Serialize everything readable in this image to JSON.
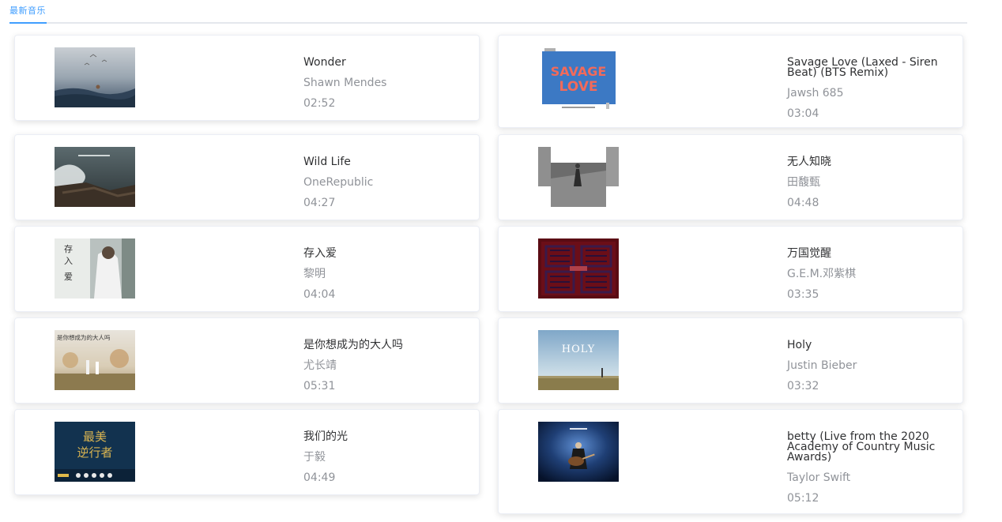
{
  "tabs": {
    "active_label": "最新音乐"
  },
  "songs": [
    {
      "title": "Wonder",
      "artist": "Shawn Mendes",
      "duration": "02:52"
    },
    {
      "title": "Savage Love (Laxed - Siren Beat) (BTS Remix)",
      "artist": "Jawsh 685",
      "duration": "03:04",
      "cover_text": "SAVAGE LOVE"
    },
    {
      "title": "Wild Life",
      "artist": "OneRepublic",
      "duration": "04:27"
    },
    {
      "title": "无人知晓",
      "artist": "田馥甄",
      "duration": "04:48"
    },
    {
      "title": "存入爱",
      "artist": "黎明",
      "duration": "04:04",
      "cover_text": "存入爱"
    },
    {
      "title": "万国觉醒",
      "artist": "G.E.M.邓紫棋",
      "duration": "03:35"
    },
    {
      "title": "是你想成为的大人吗",
      "artist": "尤长靖",
      "duration": "05:31",
      "cover_text": "是你想成为的大人吗"
    },
    {
      "title": "Holy",
      "artist": "Justin Bieber",
      "duration": "03:32",
      "cover_text": "HOLY"
    },
    {
      "title": "我们的光",
      "artist": "于毅",
      "duration": "04:49",
      "cover_text": "最美逆行者"
    },
    {
      "title": "betty (Live from the 2020 Academy of Country Music Awards)",
      "artist": "Taylor Swift",
      "duration": "05:12"
    }
  ],
  "colors": {
    "accent": "#409eff",
    "title": "#303133",
    "secondary": "#909399"
  }
}
